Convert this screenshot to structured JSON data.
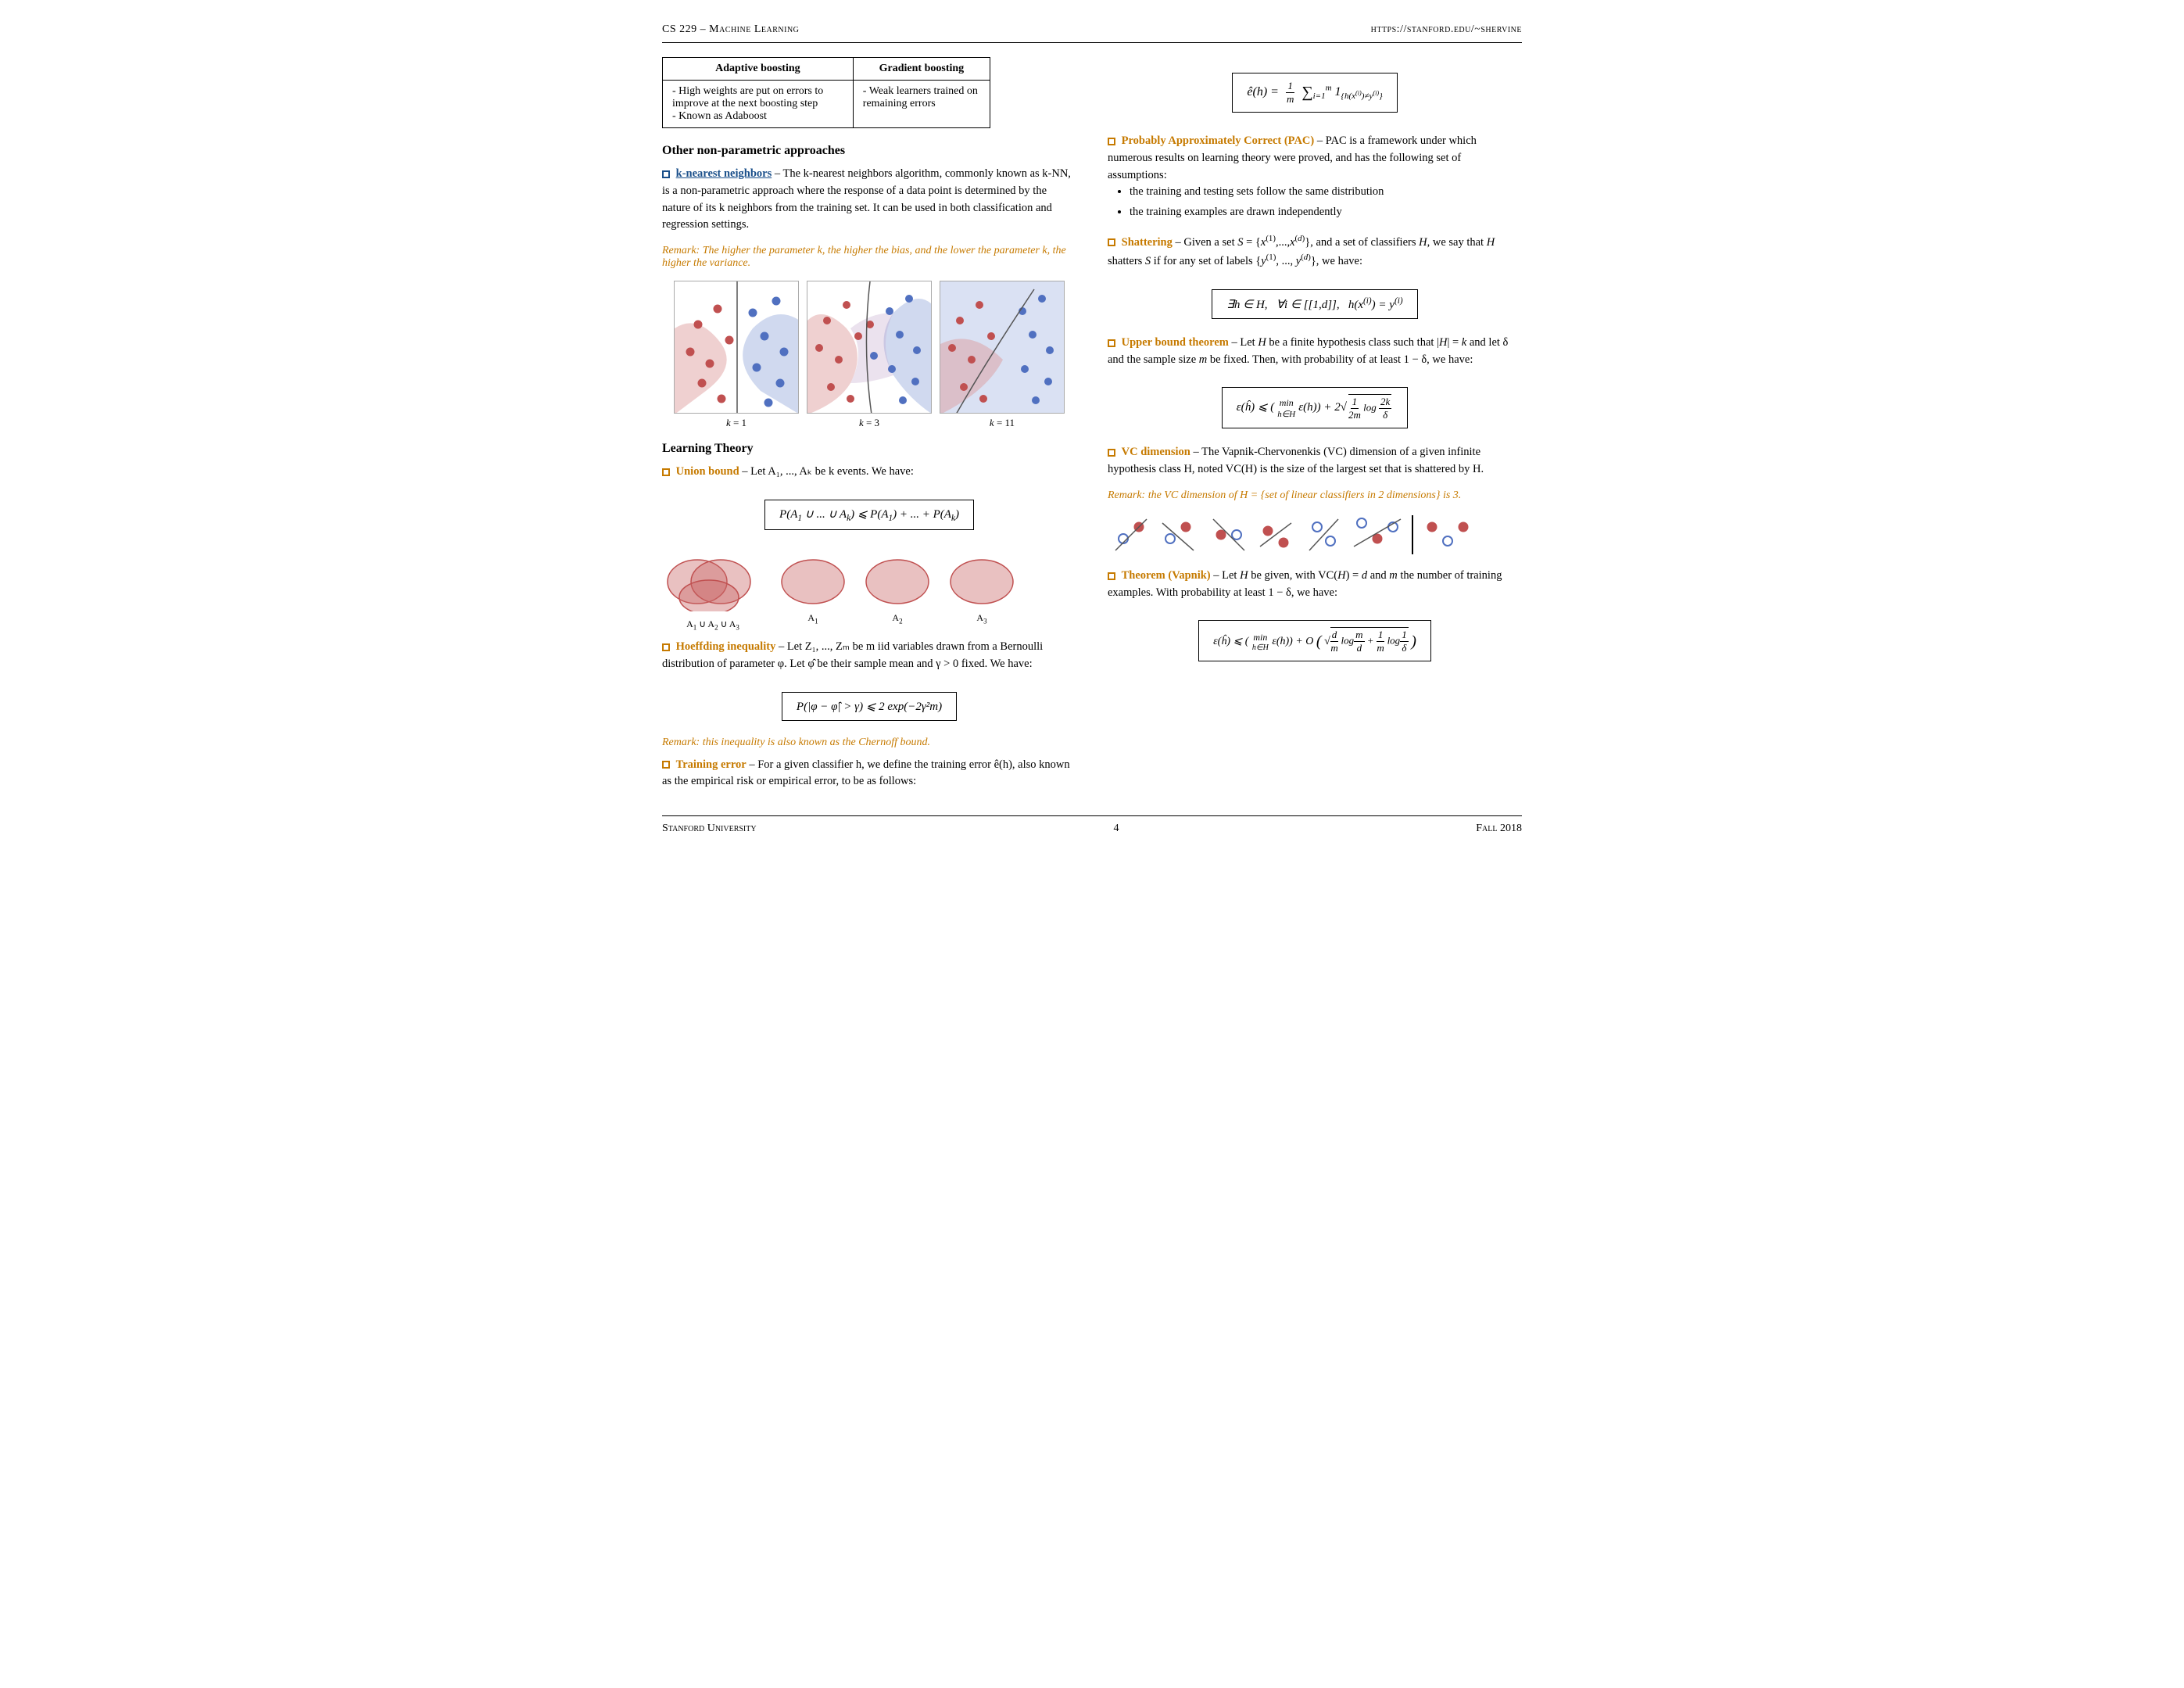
{
  "header": {
    "left": "CS 229 – Machine Learning",
    "right": "https://stanford.edu/~shervine"
  },
  "footer": {
    "left": "Stanford University",
    "center": "4",
    "right": "Fall 2018"
  },
  "table": {
    "col1_header": "Adaptive boosting",
    "col2_header": "Gradient boosting",
    "col1_row1": "- High weights are put on errors to improve at the next boosting step",
    "col1_row2": "- Known as Adaboost",
    "col2_row1": "- Weak learners trained on remaining errors"
  },
  "left_col": {
    "section1_title": "Other non-parametric approaches",
    "knn_square_color": "#1a4f8a",
    "knn_title": "k-nearest neighbors",
    "knn_text": "– The k-nearest neighbors algorithm, commonly known as k-NN, is a non-parametric approach where the response of a data point is determined by the nature of its k neighbors from the training set. It can be used in both classification and regression settings.",
    "knn_remark": "Remark: The higher the parameter k, the higher the bias, and the lower the parameter k, the higher the variance.",
    "knn_labels": [
      "k = 1",
      "k = 3",
      "k = 11"
    ],
    "section2_title": "Learning Theory",
    "union_square_color": "#c67a00",
    "union_title": "Union bound",
    "union_text": "– Let A₁, ..., Aₖ be k events.  We have:",
    "union_formula": "P(A₁ ∪ ... ∪ Aₖ) ⩽ P(A₁) + ... + P(Aₖ)",
    "union_diagram_labels": [
      "A₁ ∪ A₂ ∪ A₃",
      "A₁",
      "A₂",
      "A₃"
    ],
    "hoeffding_square_color": "#c67a00",
    "hoeffding_title": "Hoeffding inequality",
    "hoeffding_text": "– Let Z₁, ..., Zₘ be m iid variables drawn from a Bernoulli distribution of parameter φ. Let φ̂ be their sample mean and γ > 0 fixed.  We have:",
    "hoeffding_formula": "P(|φ − φ̂| > γ) ⩽ 2 exp(−2γ²m)",
    "hoeffding_remark": "Remark: this inequality is also known as the Chernoff bound.",
    "training_square_color": "#c67a00",
    "training_title": "Training error",
    "training_text": "– For a given classifier h, we define the training error ê(h), also known as the empirical risk or empirical error, to be as follows:"
  },
  "right_col": {
    "training_formula_text": "ê(h) = (1/m) Σ 1{h(x⁽ⁱ⁾) ≠ y⁽ⁱ⁾}",
    "pac_square_color": "#c67a00",
    "pac_title": "Probably Approximately Correct (PAC)",
    "pac_text": "– PAC is a framework under which numerous results on learning theory were proved, and has the following set of assumptions:",
    "pac_bullets": [
      "the training and testing sets follow the same distribution",
      "the training examples are drawn independently"
    ],
    "shattering_square_color": "#c67a00",
    "shattering_title": "Shattering",
    "shattering_text": "– Given a set S = {x⁽¹⁾,...,x⁽ᵈ⁾}, and a set of classifiers H, we say that H shatters S if for any set of labels {y⁽¹⁾, ..., y⁽ᵈ⁾}, we have:",
    "shattering_formula": "∃h ∈ H,   ∀i ∈ [[1,d]],   h(x⁽ⁱ⁾) = y⁽ⁱ⁾",
    "upper_bound_square_color": "#c67a00",
    "upper_bound_title": "Upper bound theorem",
    "upper_bound_text": "– Let H be a finite hypothesis class such that |H| = k and let δ and the sample size m be fixed.  Then, with probability of at least 1 − δ, we have:",
    "upper_bound_formula": "ε(ĥ) ⩽ (min ε(h)) + 2√(1/2m · log(2k/δ))",
    "vc_square_color": "#c67a00",
    "vc_title": "VC dimension",
    "vc_text": "– The Vapnik-Chervonenkis (VC) dimension of a given infinite hypothesis class H, noted VC(H) is the size of the largest set that is shattered by H.",
    "vc_remark": "Remark: the VC dimension of H = {set of linear classifiers in 2 dimensions} is 3.",
    "vapnik_square_color": "#c67a00",
    "vapnik_title": "Theorem (Vapnik)",
    "vapnik_text": "– Let H be given, with VC(H) = d and m the number of training examples.  With probability at least 1 − δ, we have:",
    "vapnik_formula": "ε(ĥ) ⩽ (min ε(h)) + O(√(d/m·log(m/d) + 1/m·log(1/δ)))"
  }
}
